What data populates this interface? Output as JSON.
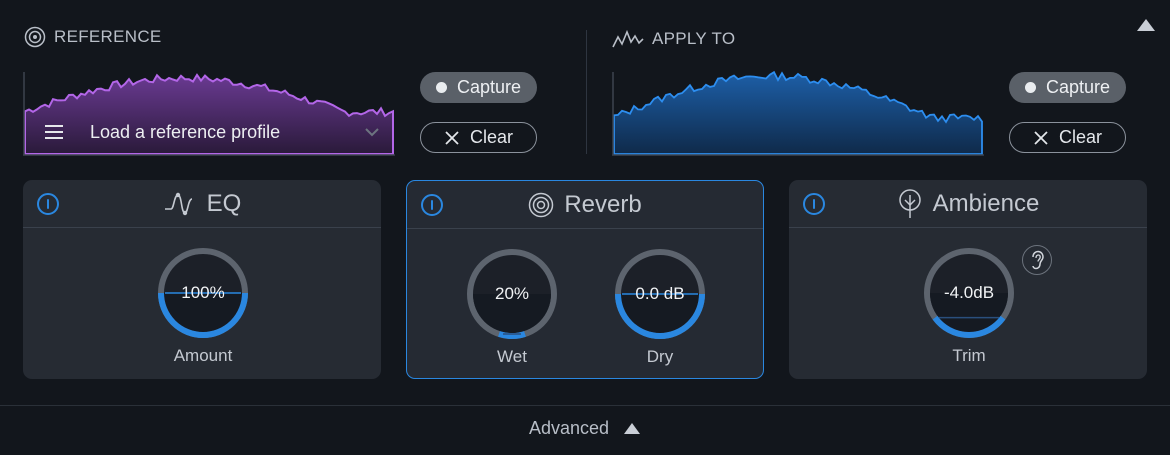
{
  "reference": {
    "title": "REFERENCE",
    "icon": "target-icon",
    "profile_label": "Load a reference profile",
    "capture_label": "Capture",
    "clear_label": "Clear",
    "color": "#a55ad8"
  },
  "apply_to": {
    "title": "APPLY TO",
    "icon": "waveform-icon",
    "capture_label": "Capture",
    "clear_label": "Clear",
    "color": "#1f7fe0"
  },
  "modules": {
    "eq": {
      "title": "EQ",
      "knob_value": "100%",
      "knob_label": "Amount",
      "level": 1.0
    },
    "reverb": {
      "title": "Reverb",
      "wet": {
        "value": "20%",
        "label": "Wet",
        "level": 0.2
      },
      "dry": {
        "value": "0.0 dB",
        "label": "Dry",
        "level": 1.0
      }
    },
    "ambience": {
      "title": "Ambience",
      "knob_value": "-4.0dB",
      "knob_label": "Trim",
      "level": 0.6
    }
  },
  "footer": {
    "advanced_label": "Advanced"
  },
  "colors": {
    "accent": "#2a87e0",
    "background": "#12161c",
    "card": "#262b33"
  }
}
